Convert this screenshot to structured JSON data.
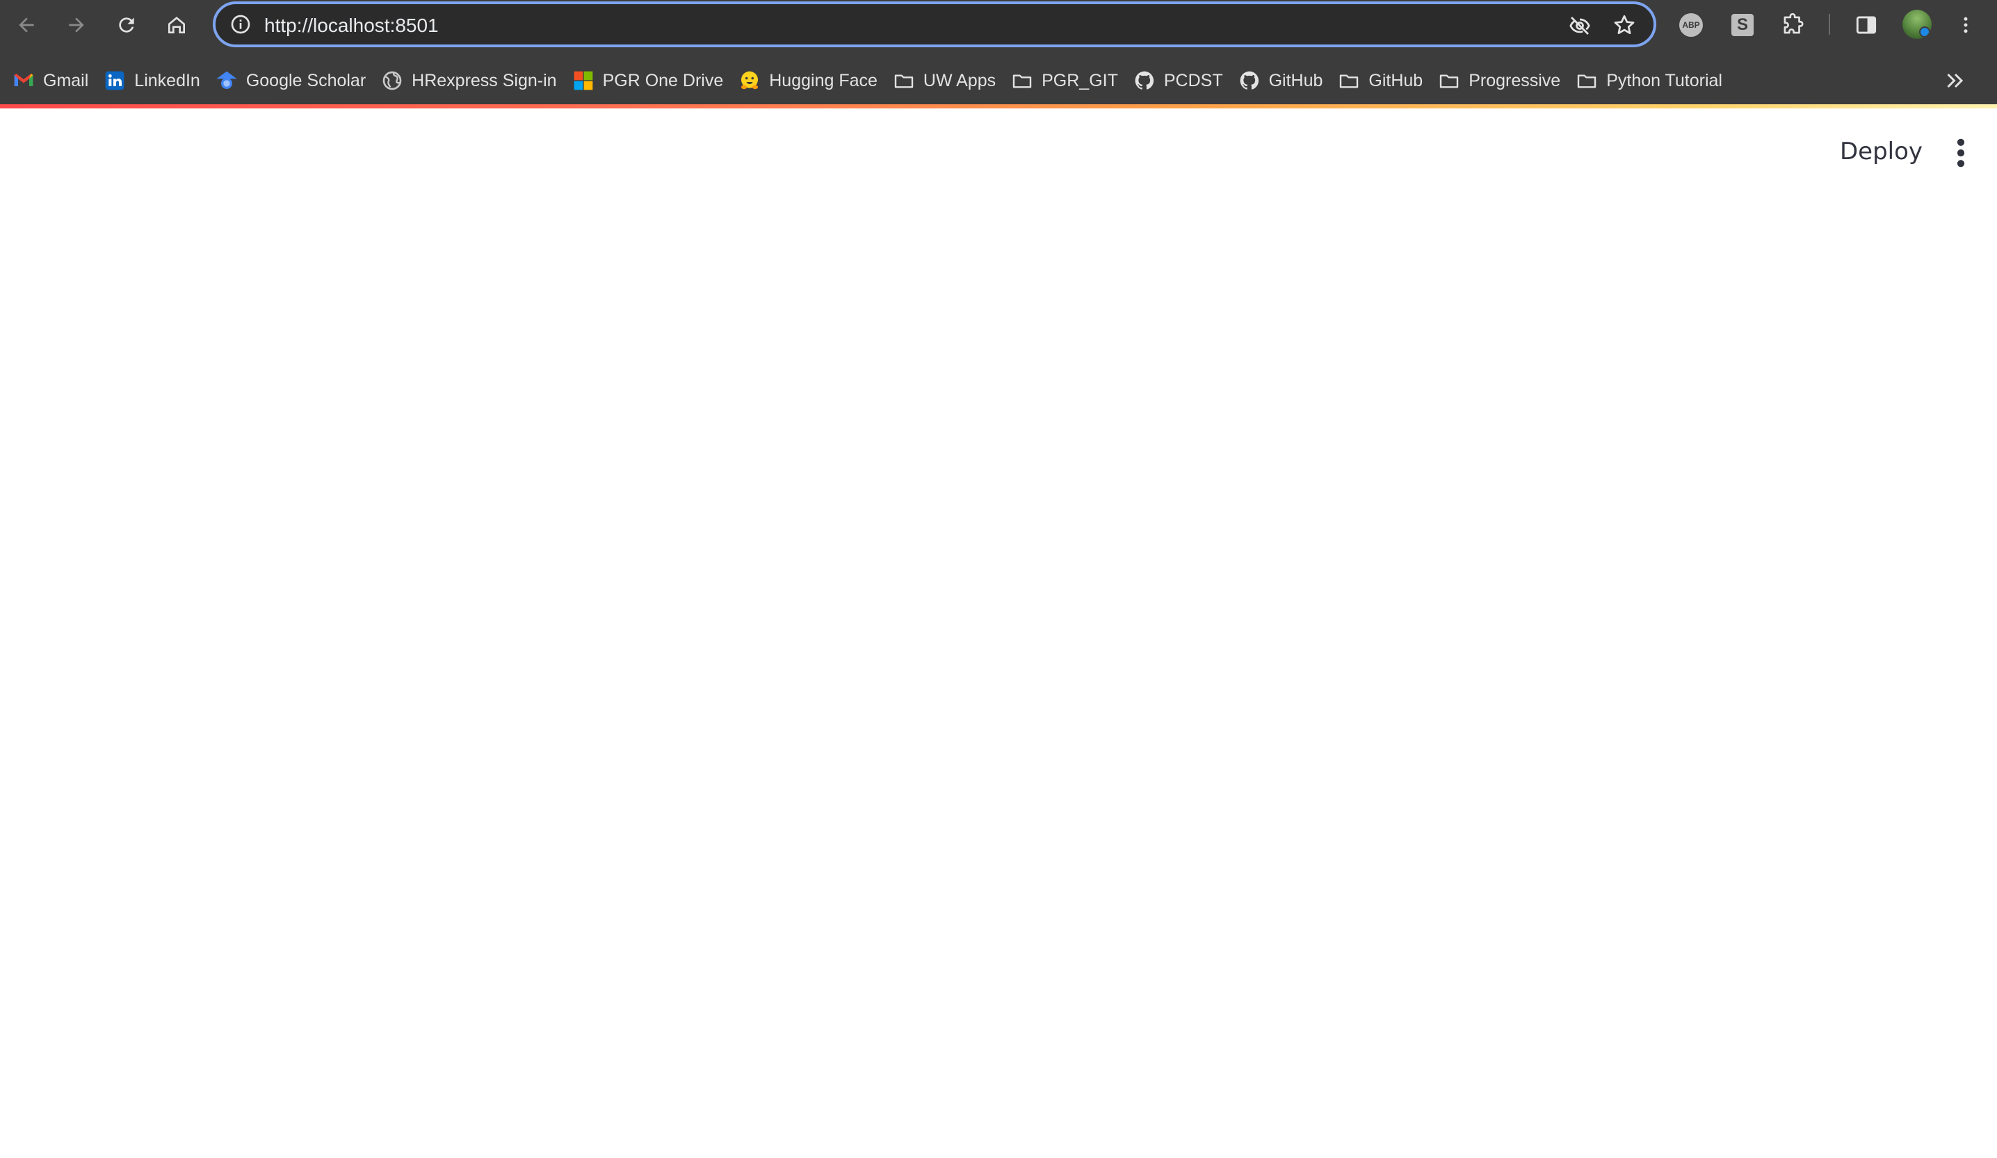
{
  "browser": {
    "url": "http://localhost:8501",
    "accent_color": "#7ea4f0",
    "chrome_color": "#3c3c3c",
    "icons": {
      "back": "arrow-left-icon",
      "forward": "arrow-right-icon",
      "reload": "reload-icon",
      "home": "home-icon",
      "site_info": "info-icon",
      "tracking": "eye-slash-icon",
      "bookmark": "star-icon",
      "extensions": "puzzle-icon",
      "side_panel": "side-panel-icon",
      "menu": "kebab-icon"
    },
    "extensions": {
      "abp_label": "ABP",
      "s_label": "S"
    }
  },
  "bookmarks": [
    {
      "label": "Gmail",
      "icon": "gmail-icon"
    },
    {
      "label": "LinkedIn",
      "icon": "linkedin-icon"
    },
    {
      "label": "Google Scholar",
      "icon": "scholar-icon"
    },
    {
      "label": "HRexpress Sign-in",
      "icon": "globe-icon"
    },
    {
      "label": "PGR One Drive",
      "icon": "microsoft-icon"
    },
    {
      "label": "Hugging Face",
      "icon": "hugging-face-icon"
    },
    {
      "label": "UW Apps",
      "icon": "folder-icon"
    },
    {
      "label": "PGR_GIT",
      "icon": "folder-icon"
    },
    {
      "label": "PCDST",
      "icon": "github-icon"
    },
    {
      "label": "GitHub",
      "icon": "github-icon"
    },
    {
      "label": "GitHub",
      "icon": "folder-icon"
    },
    {
      "label": "Progressive",
      "icon": "folder-icon"
    },
    {
      "label": "Python Tutorial",
      "icon": "folder-icon"
    }
  ],
  "app": {
    "deploy_label": "Deploy",
    "menu_icon": "kebab-icon"
  }
}
